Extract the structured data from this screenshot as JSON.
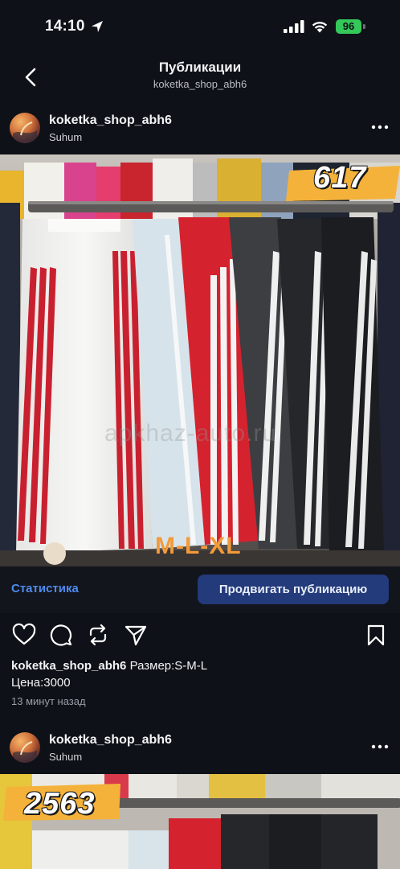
{
  "status": {
    "time": "14:10",
    "battery": "96"
  },
  "header": {
    "title": "Публикации",
    "subtitle": "koketka_shop_abh6"
  },
  "post1": {
    "username": "koketka_shop_abh6",
    "location": "Suhum",
    "price_tag": "617",
    "sizes": "M-L-XL",
    "watermark": "apkhaz-auto.ru",
    "stats_label": "Статистика",
    "promote_label": "Продвигать публикацию",
    "caption_user": "koketka_shop_abh6",
    "caption_line1": "Размер:S-M-L",
    "caption_line2": "Цена:3000",
    "time_ago": "13 минут назад"
  },
  "post2": {
    "username": "koketka_shop_abh6",
    "location": "Suhum",
    "price_tag": "2563"
  },
  "icons": {
    "back": "chevron-left-icon",
    "more": "more-horizontal-icon",
    "like": "heart-icon",
    "comment": "comment-icon",
    "repost": "repost-icon",
    "share": "send-icon",
    "save": "bookmark-icon"
  },
  "colors": {
    "accent": "#4d8bf0",
    "button": "#233a7b",
    "background": "#0e1117",
    "battery": "#34c759"
  }
}
